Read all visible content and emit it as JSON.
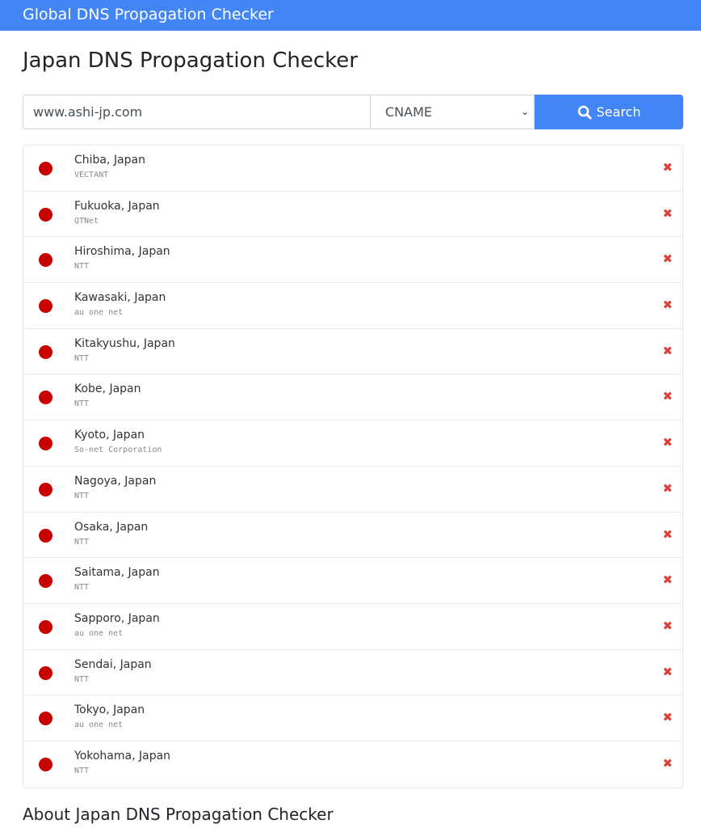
{
  "navbar": {
    "title": "Global DNS Propagation Checker"
  },
  "page": {
    "title": "Japan DNS Propagation Checker"
  },
  "form": {
    "domain_value": "www.ashi-jp.com",
    "record_type": "CNAME",
    "search_label": "Search"
  },
  "colors": {
    "accent": "#4285f4",
    "status_fail": "#c80000",
    "x_mark": "#d9433c"
  },
  "results": [
    {
      "location": "Chiba, Japan",
      "provider": "VECTANT",
      "status": "fail"
    },
    {
      "location": "Fukuoka, Japan",
      "provider": "QTNet",
      "status": "fail"
    },
    {
      "location": "Hiroshima, Japan",
      "provider": "NTT",
      "status": "fail"
    },
    {
      "location": "Kawasaki, Japan",
      "provider": "au one net",
      "status": "fail"
    },
    {
      "location": "Kitakyushu, Japan",
      "provider": "NTT",
      "status": "fail"
    },
    {
      "location": "Kobe, Japan",
      "provider": "NTT",
      "status": "fail"
    },
    {
      "location": "Kyoto, Japan",
      "provider": "So-net Corporation",
      "status": "fail"
    },
    {
      "location": "Nagoya, Japan",
      "provider": "NTT",
      "status": "fail"
    },
    {
      "location": "Osaka, Japan",
      "provider": "NTT",
      "status": "fail"
    },
    {
      "location": "Saitama, Japan",
      "provider": "NTT",
      "status": "fail"
    },
    {
      "location": "Sapporo, Japan",
      "provider": "au one net",
      "status": "fail"
    },
    {
      "location": "Sendai, Japan",
      "provider": "NTT",
      "status": "fail"
    },
    {
      "location": "Tokyo, Japan",
      "provider": "au one net",
      "status": "fail"
    },
    {
      "location": "Yokohama, Japan",
      "provider": "NTT",
      "status": "fail"
    }
  ],
  "about": {
    "title": "About Japan DNS Propagation Checker"
  }
}
